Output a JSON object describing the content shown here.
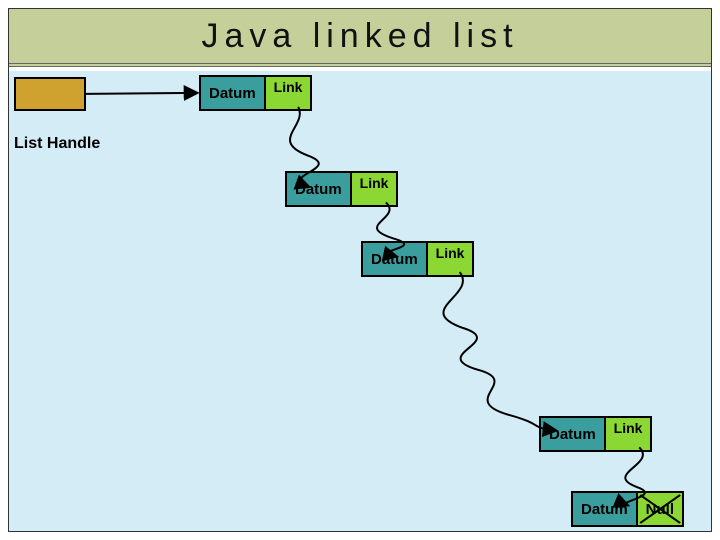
{
  "title": "Java  linked  list",
  "labels": {
    "list_handle": "List Handle",
    "datum": "Datum",
    "link": "Link",
    "null": "Null"
  },
  "chart_data": {
    "type": "diagram",
    "title": "Java linked list",
    "nodes": [
      {
        "id": "handle",
        "kind": "handle",
        "label": "List Handle"
      },
      {
        "id": "n1",
        "kind": "node",
        "datum": "Datum",
        "link": "Link"
      },
      {
        "id": "n2",
        "kind": "node",
        "datum": "Datum",
        "link": "Link"
      },
      {
        "id": "n3",
        "kind": "node",
        "datum": "Datum",
        "link": "Link"
      },
      {
        "id": "n4",
        "kind": "node",
        "datum": "Datum",
        "link": "Link"
      },
      {
        "id": "n5",
        "kind": "node",
        "datum": "Datum",
        "link": "Null",
        "is_terminal": true
      }
    ],
    "edges": [
      {
        "from": "handle",
        "to": "n1"
      },
      {
        "from": "n1",
        "to": "n2"
      },
      {
        "from": "n2",
        "to": "n3"
      },
      {
        "from": "n3",
        "to": "n4",
        "style": "squiggle-long"
      },
      {
        "from": "n4",
        "to": "n5"
      }
    ]
  }
}
